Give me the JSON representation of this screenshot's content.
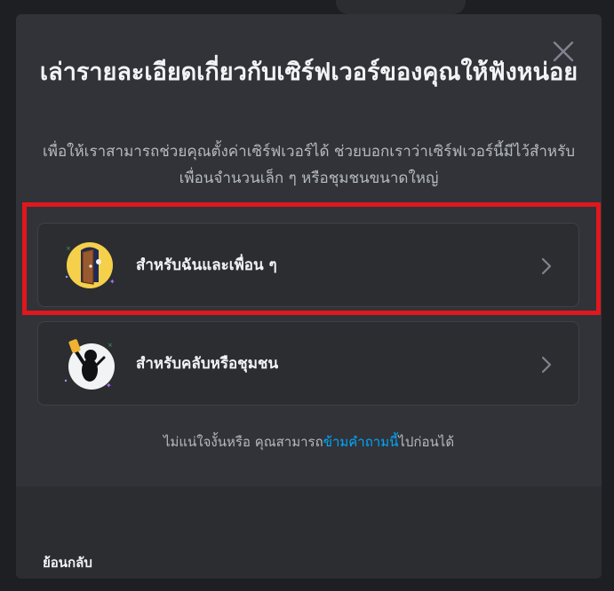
{
  "modal": {
    "title": "เล่ารายละเอียดเกี่ยวกับเซิร์ฟเวอร์ของคุณให้ฟังหน่อย",
    "subtitle": "เพื่อให้เราสามารถช่วยคุณตั้งค่าเซิร์ฟเวอร์ได้ ช่วยบอกเราว่าเซิร์ฟเวอร์นี้มีไว้สำหรับเพื่อนจำนวนเล็ก ๆ หรือชุมชนขนาดใหญ่",
    "close_icon": "close-icon"
  },
  "options": [
    {
      "label": "สำหรับฉันและเพื่อน ๆ",
      "icon": "door-illustration"
    },
    {
      "label": "สำหรับคลับหรือชุมชน",
      "icon": "community-illustration"
    }
  ],
  "skip": {
    "prefix": "ไม่แน่ใจงั้นหรือ คุณสามารถ",
    "link": "ข้ามคำถามนี้",
    "suffix": "ไปก่อนได้"
  },
  "footer": {
    "back_label": "ย้อนกลับ"
  },
  "colors": {
    "backdrop": "#1e1f22",
    "modal": "#313338",
    "card": "#2b2d31",
    "link": "#00a8fc",
    "highlight": "#e0171d"
  }
}
